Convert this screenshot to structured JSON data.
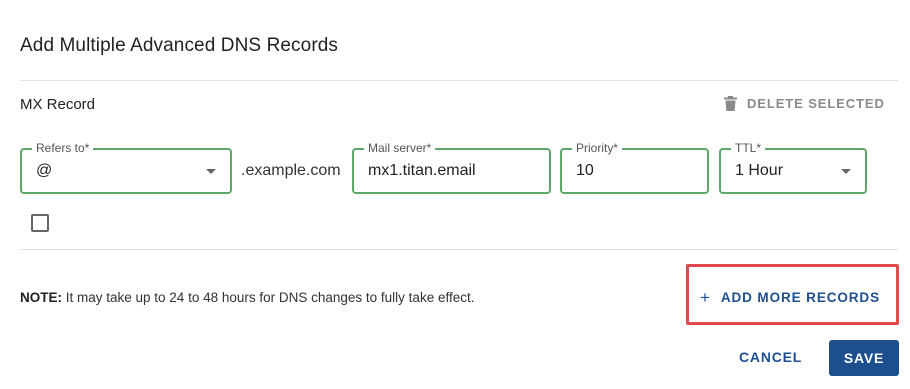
{
  "dialog": {
    "title": "Add Multiple Advanced DNS Records"
  },
  "record": {
    "type_label": "MX Record",
    "delete_label": "DELETE SELECTED",
    "fields": {
      "refers_to": {
        "label": "Refers to*",
        "value": "@"
      },
      "domain_suffix": ".example.com",
      "mail_server": {
        "label": "Mail server*",
        "value": "mx1.titan.email"
      },
      "priority": {
        "label": "Priority*",
        "value": "10"
      },
      "ttl": {
        "label": "TTL*",
        "value": "1 Hour"
      }
    },
    "selected": false
  },
  "note": {
    "prefix": "NOTE:",
    "text": " It may take up to 24 to 48 hours for DNS changes to fully take effect."
  },
  "actions": {
    "add_more_icon": "+",
    "add_more_label": "ADD MORE RECORDS",
    "cancel_label": "CANCEL",
    "save_label": "SAVE"
  },
  "colors": {
    "field_border": "#5fa86b",
    "primary": "#1d4f8f",
    "highlight": "#e0494d"
  }
}
